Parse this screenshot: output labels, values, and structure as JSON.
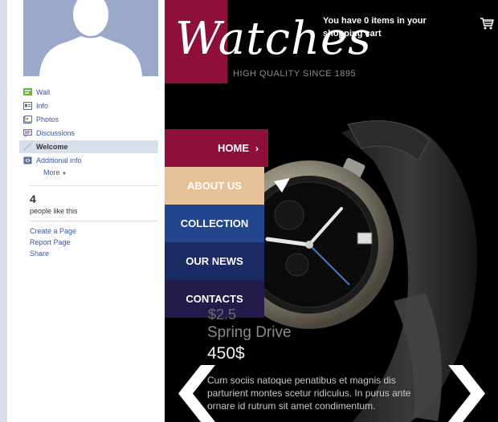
{
  "sidebar": {
    "nav": [
      {
        "label": "Wall",
        "icon": "wall-icon"
      },
      {
        "label": "Info",
        "icon": "info-icon"
      },
      {
        "label": "Photos",
        "icon": "photos-icon"
      },
      {
        "label": "Discussions",
        "icon": "discussions-icon"
      },
      {
        "label": "Welcome",
        "icon": "welcome-icon",
        "active": true
      },
      {
        "label": "Additional info",
        "icon": "additional-info-icon"
      }
    ],
    "more_label": "More",
    "likes_count": "4",
    "likes_label": "people like this",
    "links": [
      "Create a Page",
      "Report Page",
      "Share"
    ]
  },
  "app": {
    "logo": "Watches",
    "tagline": "HIGH QUALITY SINCE 1895",
    "cart": "You have 0 items in your shopping cart",
    "menu": {
      "home": "HOME",
      "about": "ABOUT US",
      "collection": "COLLECTION",
      "news": "OUR NEWS",
      "contacts": "CONTACTS"
    },
    "product": {
      "price_top": "$2.5",
      "name": "Spring Drive",
      "price": "450$",
      "description": "Cum sociis natoque penatibus et magnis  dis parturient montes scetur ridiculus. In purus ante ornare id rutrum sit amet condimentum."
    }
  },
  "colors": {
    "facebook_blue": "#3b5998",
    "rail": "#d8dfea",
    "brand": "#8e0f3c",
    "about": "#e7c19a",
    "collection": "#24468f",
    "news": "#1a2b63",
    "contacts": "#251b4b"
  }
}
